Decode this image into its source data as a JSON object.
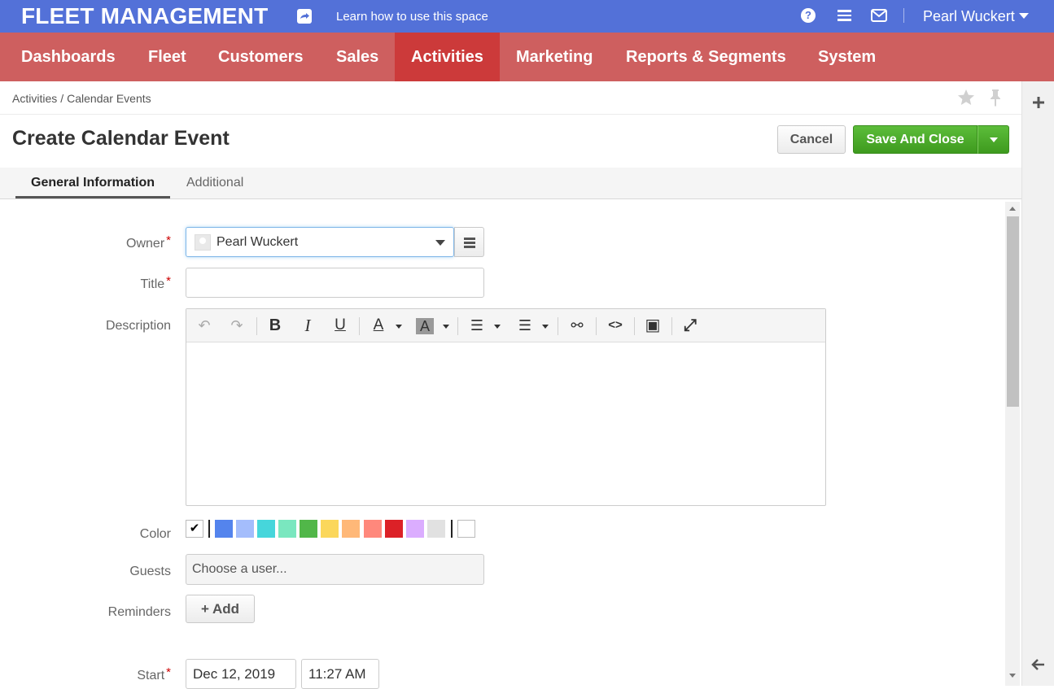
{
  "topbar": {
    "brand": "FLEET MANAGEMENT",
    "learn_link": "Learn how to use this space",
    "help_glyph": "?",
    "user_name": "Pearl Wuckert",
    "bg_color": "#5371d8"
  },
  "nav": {
    "items": [
      {
        "label": "Dashboards"
      },
      {
        "label": "Fleet"
      },
      {
        "label": "Customers"
      },
      {
        "label": "Sales"
      },
      {
        "label": "Activities",
        "active": true
      },
      {
        "label": "Marketing"
      },
      {
        "label": "Reports & Segments"
      },
      {
        "label": "System"
      }
    ],
    "bg_color": "#ce5f5f",
    "active_color": "#cc3a3a"
  },
  "breadcrumb": {
    "items": [
      "Activities",
      "Calendar Events"
    ],
    "separator": "/"
  },
  "page": {
    "title": "Create Calendar Event",
    "cancel_label": "Cancel",
    "save_label": "Save And Close"
  },
  "tabs": [
    {
      "label": "General Information",
      "active": true
    },
    {
      "label": "Additional"
    }
  ],
  "form": {
    "owner_label": "Owner",
    "owner_value": "Pearl Wuckert",
    "title_label": "Title",
    "title_value": "",
    "description_label": "Description",
    "color_label": "Color",
    "colors": [
      "#5484ed",
      "#a4bdfc",
      "#46d6db",
      "#7ae7bf",
      "#51b749",
      "#fbd75b",
      "#ffb878",
      "#ff887c",
      "#dc2127",
      "#dbadff",
      "#e1e1e1"
    ],
    "color_selected_glyph": "✔",
    "guests_label": "Guests",
    "guests_placeholder": "Choose a user...",
    "reminders_label": "Reminders",
    "add_label": "+ Add",
    "start_label": "Start",
    "start_date": "Dec 12, 2019",
    "start_time": "11:27 AM",
    "required_mark": "*"
  },
  "editor_toolbar": {
    "undo_glyph": "↶",
    "redo_glyph": "↷",
    "bold_glyph": "B",
    "italic_glyph": "I",
    "underline_glyph": "U",
    "text_color_glyph": "A",
    "bg_color_glyph": "A",
    "bullet_glyph": "☰",
    "numbered_glyph": "☰",
    "link_glyph": "⚯",
    "code_glyph": "<>",
    "image_glyph": "▣",
    "fullscreen_glyph": "⤢"
  }
}
